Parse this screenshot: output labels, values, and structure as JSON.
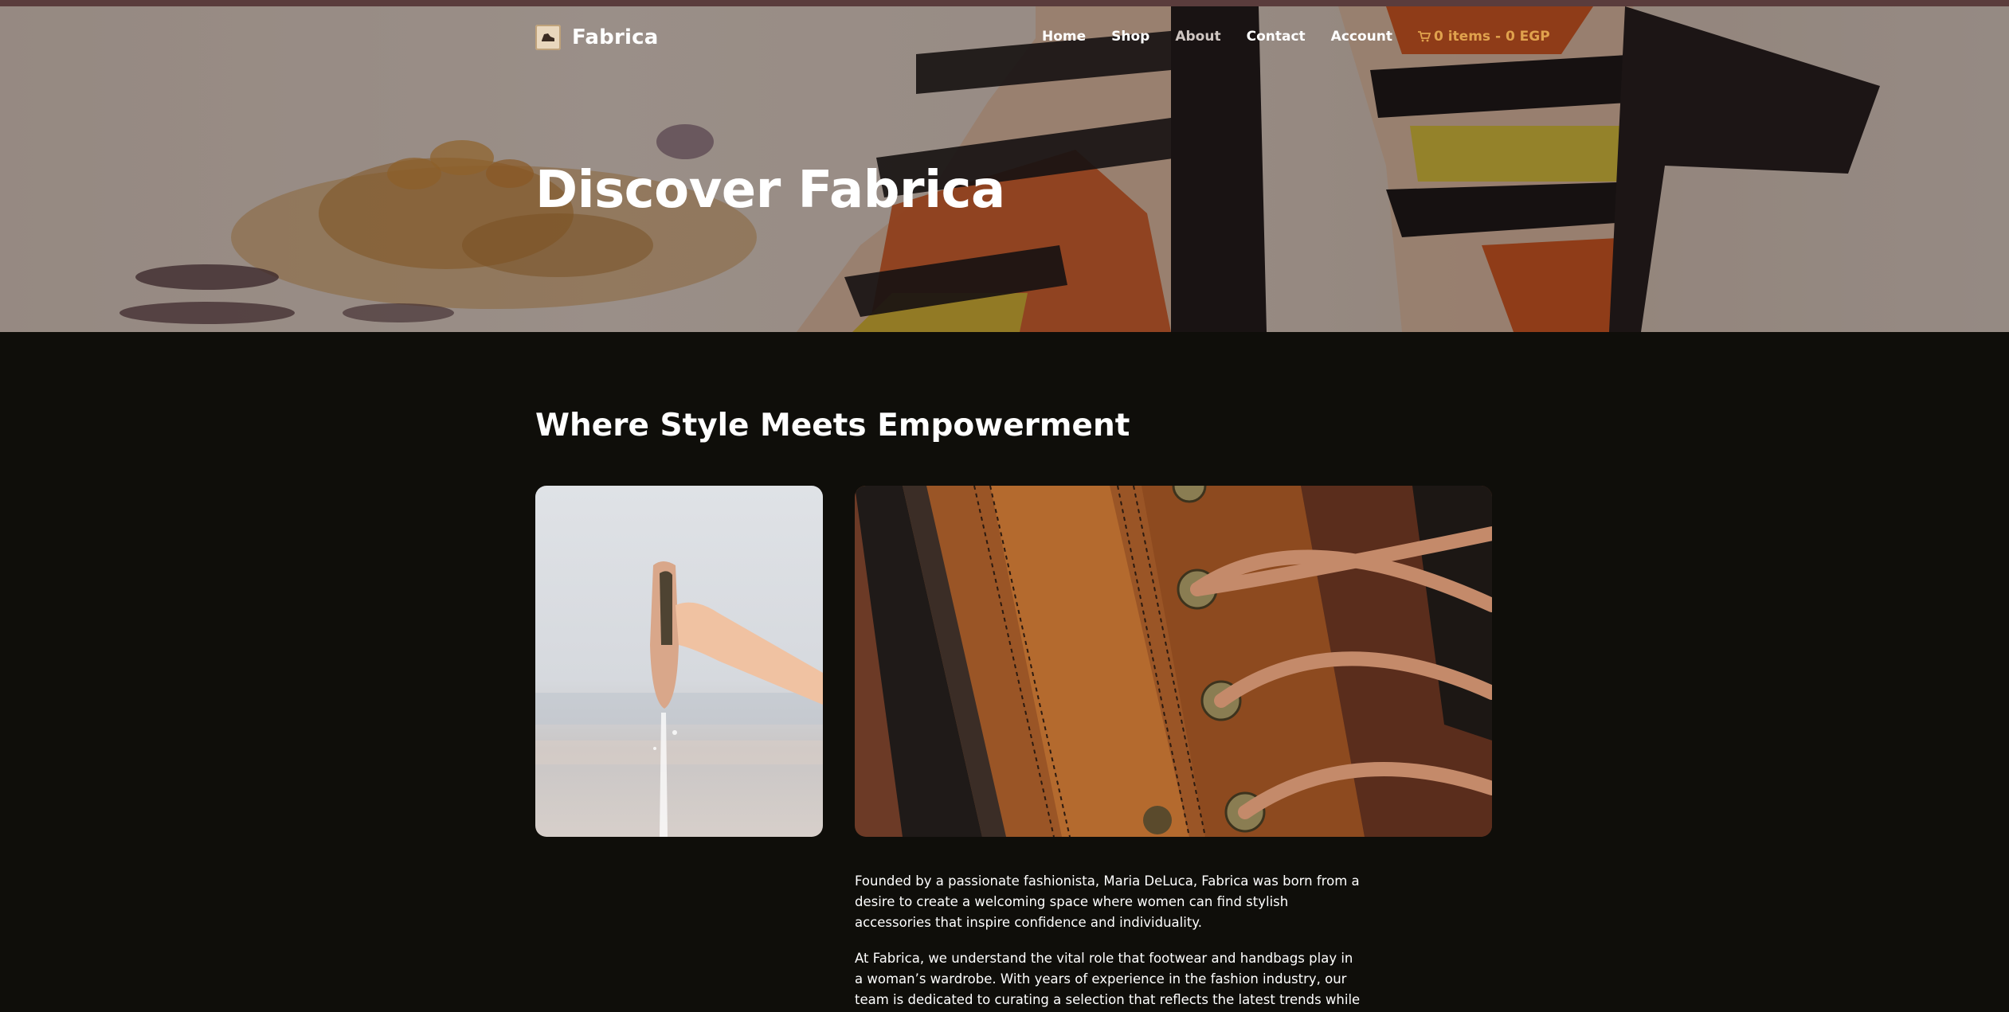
{
  "site": {
    "name": "Fabrica"
  },
  "nav": {
    "items": [
      {
        "label": "Home",
        "active": false
      },
      {
        "label": "Shop",
        "active": false
      },
      {
        "label": "About",
        "active": true
      },
      {
        "label": "Contact",
        "active": false
      },
      {
        "label": "Account",
        "active": false
      }
    ],
    "cart": {
      "icon": "cart-icon",
      "label": "0 items - 0 EGP"
    }
  },
  "hero": {
    "title": "Discover Fabrica"
  },
  "main": {
    "heading": "Where Style Meets Empowerment",
    "paragraphs": [
      "Founded by a passionate fashionista, Maria DeLuca, Fabrica was born from a desire to create a welcoming space where women can find stylish accessories that inspire confidence and individuality.",
      "At Fabrica, we understand the vital role that footwear and handbags play in a woman’s wardrobe. With years of experience in the fashion industry, our team is dedicated to curating a selection that reflects the latest trends while honoring"
    ]
  },
  "colors": {
    "top_strip": "#5a3c3c",
    "background": "#0f0e0a",
    "cart_accent": "#e0a24d",
    "nav_active": "#cfc6c2"
  }
}
